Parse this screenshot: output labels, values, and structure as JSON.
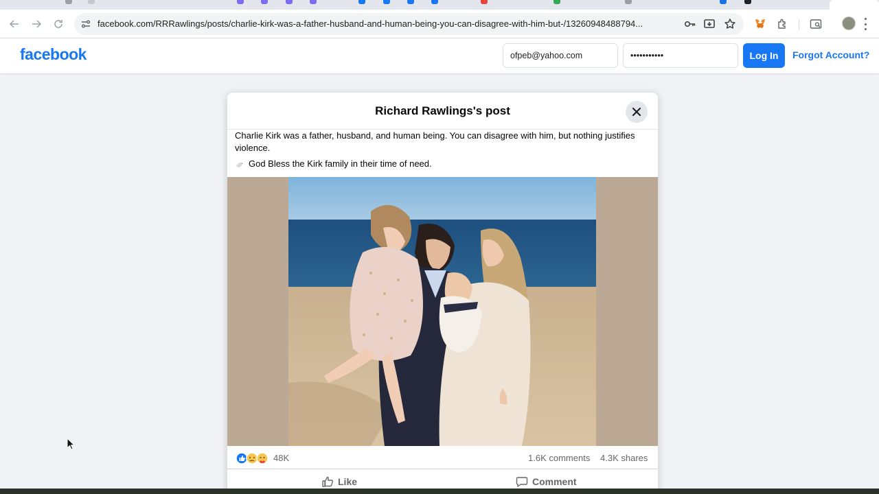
{
  "browser": {
    "url": "facebook.com/RRRawlings/posts/charlie-kirk-was-a-father-husband-and-human-being-you-can-disagree-with-him-but-/13260948488794...",
    "icons": [
      "back-arrow-icon",
      "forward-arrow-icon",
      "reload-icon",
      "site-settings-icon",
      "password-key-icon",
      "install-app-icon",
      "bookmark-star-icon",
      "metamask-extension-icon",
      "extensions-puzzle-icon",
      "reading-list-icon",
      "profile-avatar-icon",
      "menu-dots-icon"
    ]
  },
  "header": {
    "logo": "facebook",
    "email_value": "ofpeb@yahoo.com",
    "password_value": "•••••••••••",
    "login_label": "Log In",
    "forgot_label": "Forgot Account?",
    "brand_color": "#1877f2"
  },
  "modal": {
    "title": "Richard Rawlings's post",
    "post_text": "Charlie Kirk was a father, husband, and human being. You can disagree with him, but nothing justifies violence.",
    "post_line2": "God Bless the Kirk family in their time of need.",
    "reaction_icons": [
      "like-reaction-icon",
      "sad-reaction-icon",
      "care-reaction-icon"
    ],
    "reaction_count": "48K",
    "comments_count": "1.6K comments",
    "shares_count": "4.3K shares",
    "like_label": "Like",
    "comment_label": "Comment"
  }
}
